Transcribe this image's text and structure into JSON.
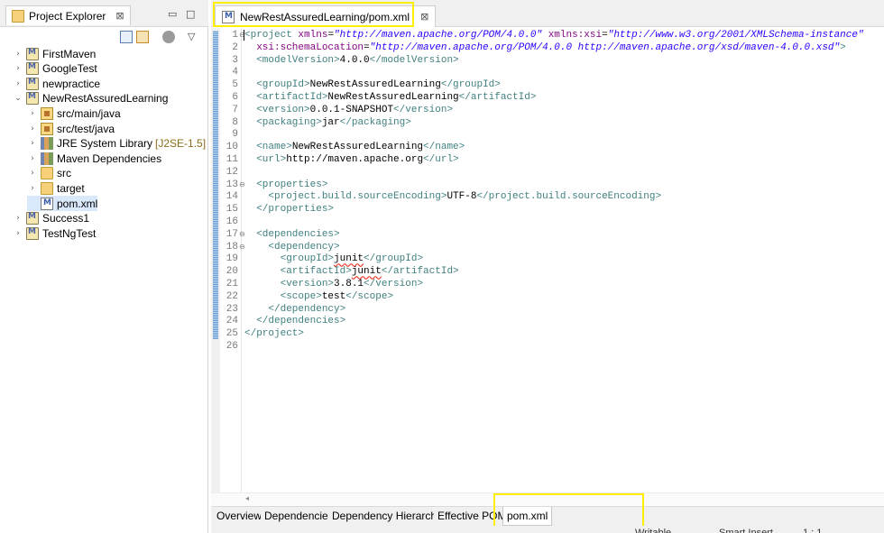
{
  "explorer": {
    "title": "Project Explorer",
    "close": "⊠",
    "minimize": "▭",
    "maximize": "□",
    "menu": "▽",
    "tree": [
      {
        "label": "FirstMaven",
        "twisty": "›",
        "icon": "maven-project-icon",
        "level": 0
      },
      {
        "label": "GoogleTest",
        "twisty": "›",
        "icon": "maven-project-icon",
        "level": 0
      },
      {
        "label": "newpractice",
        "twisty": "›",
        "icon": "maven-project-icon",
        "level": 0
      },
      {
        "label": "NewRestAssuredLearning",
        "twisty": "⌄",
        "icon": "maven-project-icon",
        "level": 0
      },
      {
        "label": "src/main/java",
        "twisty": "›",
        "icon": "package-folder-icon",
        "level": 1
      },
      {
        "label": "src/test/java",
        "twisty": "›",
        "icon": "package-folder-icon",
        "level": 1
      },
      {
        "label": "JRE System Library",
        "tag": "[J2SE-1.5]",
        "twisty": "›",
        "icon": "library-icon",
        "level": 1
      },
      {
        "label": "Maven Dependencies",
        "twisty": "›",
        "icon": "library-icon",
        "level": 1
      },
      {
        "label": "src",
        "twisty": "›",
        "icon": "folder-icon",
        "level": 1
      },
      {
        "label": "target",
        "twisty": "›",
        "icon": "folder-icon",
        "level": 1
      },
      {
        "label": "pom.xml",
        "twisty": "",
        "icon": "xml-file-icon",
        "level": 1
      },
      {
        "label": "Success1",
        "twisty": "›",
        "icon": "maven-project-icon",
        "level": 0
      },
      {
        "label": "TestNgTest",
        "twisty": "›",
        "icon": "maven-project-icon",
        "level": 0
      }
    ]
  },
  "editor": {
    "tab_label": "NewRestAssuredLearning/pom.xml",
    "tab_close": "⊠",
    "line_numbers": [
      "1",
      "2",
      "3",
      "4",
      "5",
      "6",
      "7",
      "8",
      "9",
      "10",
      "11",
      "12",
      "13",
      "14",
      "15",
      "16",
      "17",
      "18",
      "19",
      "20",
      "21",
      "22",
      "23",
      "24",
      "25",
      "26"
    ],
    "fold_markers": {
      "1": "⊖",
      "13": "⊖",
      "17": "⊖",
      "18": "⊖"
    },
    "lines": [
      [
        {
          "t": "<",
          "c": "tag caret"
        },
        {
          "t": "project ",
          "c": "tag"
        },
        {
          "t": "xmlns",
          "c": "attr"
        },
        {
          "t": "=",
          "c": "txt"
        },
        {
          "t": "\"http://maven.apache.org/POM/4.0.0\"",
          "c": "val"
        },
        {
          "t": " xmlns:xsi",
          "c": "attr"
        },
        {
          "t": "=",
          "c": "txt"
        },
        {
          "t": "\"http://www.w3.org/2001/XMLSchema-instance\"",
          "c": "val"
        }
      ],
      [
        {
          "t": "  xsi:schemaLocation",
          "c": "attr"
        },
        {
          "t": "=",
          "c": "txt"
        },
        {
          "t": "\"http://maven.apache.org/POM/4.0.0 http://maven.apache.org/xsd/maven-4.0.0.xsd\"",
          "c": "val"
        },
        {
          "t": ">",
          "c": "tag"
        }
      ],
      [
        {
          "t": "  <modelVersion>",
          "c": "tag"
        },
        {
          "t": "4.0.0",
          "c": "txt"
        },
        {
          "t": "</modelVersion>",
          "c": "tag"
        }
      ],
      [],
      [
        {
          "t": "  <groupId>",
          "c": "tag"
        },
        {
          "t": "NewRestAssuredLearning",
          "c": "txt"
        },
        {
          "t": "</groupId>",
          "c": "tag"
        }
      ],
      [
        {
          "t": "  <artifactId>",
          "c": "tag"
        },
        {
          "t": "NewRestAssuredLearning",
          "c": "txt"
        },
        {
          "t": "</artifactId>",
          "c": "tag"
        }
      ],
      [
        {
          "t": "  <version>",
          "c": "tag"
        },
        {
          "t": "0.0.1-SNAPSHOT",
          "c": "txt"
        },
        {
          "t": "</version>",
          "c": "tag"
        }
      ],
      [
        {
          "t": "  <packaging>",
          "c": "tag"
        },
        {
          "t": "jar",
          "c": "txt"
        },
        {
          "t": "</packaging>",
          "c": "tag"
        }
      ],
      [],
      [
        {
          "t": "  <name>",
          "c": "tag"
        },
        {
          "t": "NewRestAssuredLearning",
          "c": "txt"
        },
        {
          "t": "</name>",
          "c": "tag"
        }
      ],
      [
        {
          "t": "  <url>",
          "c": "tag"
        },
        {
          "t": "http://maven.apache.org",
          "c": "txt"
        },
        {
          "t": "</url>",
          "c": "tag"
        }
      ],
      [],
      [
        {
          "t": "  <properties>",
          "c": "tag"
        }
      ],
      [
        {
          "t": "    <project.build.sourceEncoding>",
          "c": "tag"
        },
        {
          "t": "UTF-8",
          "c": "txt"
        },
        {
          "t": "</project.build.sourceEncoding>",
          "c": "tag"
        }
      ],
      [
        {
          "t": "  </properties>",
          "c": "tag"
        }
      ],
      [],
      [
        {
          "t": "  <dependencies>",
          "c": "tag"
        }
      ],
      [
        {
          "t": "    <dependency>",
          "c": "tag"
        }
      ],
      [
        {
          "t": "      <groupId>",
          "c": "tag"
        },
        {
          "t": "junit",
          "c": "txt squig"
        },
        {
          "t": "</groupId>",
          "c": "tag"
        }
      ],
      [
        {
          "t": "      <artifactId>",
          "c": "tag"
        },
        {
          "t": "junit",
          "c": "txt squig"
        },
        {
          "t": "</artifactId>",
          "c": "tag"
        }
      ],
      [
        {
          "t": "      <version>",
          "c": "tag"
        },
        {
          "t": "3.8.1",
          "c": "txt"
        },
        {
          "t": "</version>",
          "c": "tag"
        }
      ],
      [
        {
          "t": "      <scope>",
          "c": "tag"
        },
        {
          "t": "test",
          "c": "txt"
        },
        {
          "t": "</scope>",
          "c": "tag"
        }
      ],
      [
        {
          "t": "    </dependency>",
          "c": "tag"
        }
      ],
      [
        {
          "t": "  </dependencies>",
          "c": "tag"
        }
      ],
      [
        {
          "t": "</project>",
          "c": "tag"
        }
      ],
      []
    ],
    "hscroll_arrow": "◂"
  },
  "bottom_tabs": [
    {
      "label": "Overview",
      "active": false
    },
    {
      "label": "Dependencies",
      "active": false
    },
    {
      "label": "Dependency Hierarchy",
      "active": false
    },
    {
      "label": "Effective POM",
      "active": false
    },
    {
      "label": "pom.xml",
      "active": true
    }
  ],
  "status": {
    "writable": "Writable",
    "insert_mode": "Smart Insert",
    "position": "1 : 1"
  },
  "colors": {
    "highlight": "#ffee00",
    "tag": "#3f7f7f",
    "attribute": "#7f007f",
    "value": "#2a00ff"
  }
}
